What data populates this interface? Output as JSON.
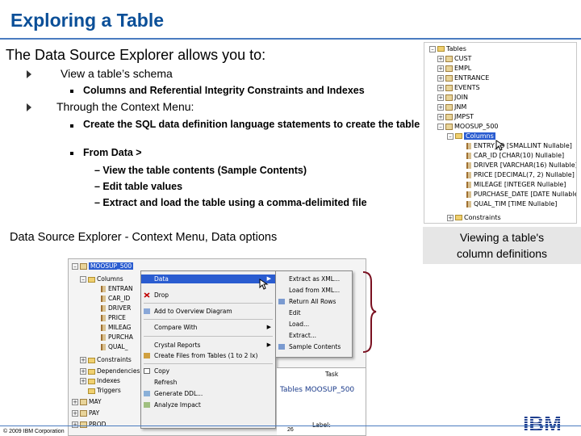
{
  "slide": {
    "title": "Exploring a Table",
    "intro": "The Data Source Explorer allows you to:",
    "bullet1": "View a table’s schema",
    "bullet1_sub1": "Columns and Referential Integrity Constraints and Indexes",
    "bullet2": "Through the Context Menu:",
    "bullet2_sub1": "Create the SQL data definition language statements to create the table",
    "bullet2_sub2": "From Data >",
    "dash1": "– View the table contents (Sample Contents)",
    "dash2": "– Edit table values",
    "dash3": "– Extract and load the table using a comma-delimited file",
    "caption": "Data Source Explorer - Context Menu,  Data options",
    "side_caption_line1": "Viewing a table's",
    "side_caption_line2": "column definitions",
    "footer_copyright": "© 2009 IBM Corporation",
    "page_number": "26",
    "logo_text": "IBM"
  },
  "tree": {
    "root": "Tables",
    "items": [
      "CUST",
      "EMPL",
      "ENTRANCE",
      "EVENTS",
      "JOIN",
      "JNM",
      "JMPST",
      "MOOSUP_500"
    ],
    "columns_folder": "Columns",
    "columns": [
      "ENTRY_ID [SMALLINT Nullable]",
      "CAR_ID [CHAR(10) Nullable]",
      "DRIVER [VARCHAR(16) Nullable]",
      "PRICE [DECIMAL(7, 2) Nullable]",
      "MILEAGE [INTEGER Nullable]",
      "PURCHASE_DATE [DATE Nullable]",
      "QUAL_TIM [TIME Nullable]"
    ],
    "constraints": "Constraints"
  },
  "context_shot": {
    "node": "MOOSUP_500",
    "tree_rows": [
      "Columns",
      "ENTRAN",
      "CAR_ID",
      "DRIVER",
      "PRICE",
      "MILEAG",
      "PURCHA",
      "QUAL_",
      "Constraints",
      "Dependencies",
      "Indexes",
      "Triggers",
      "MAY",
      "PAY",
      "PROD"
    ],
    "menu_items": [
      "Data",
      "Drop",
      "Add to Overview Diagram",
      "Compare With",
      "Crystal Reports",
      "Create Files from Tables (1 to 2 Ix)",
      "Copy",
      "Refresh",
      "Generate DDL...",
      "Analyze Impact"
    ],
    "submenu_items": [
      "Extract as XML...",
      "Load from XML...",
      "Return All Rows",
      "Edit",
      "Load...",
      "Extract...",
      "Sample Contents"
    ],
    "bottom_tab": "Task",
    "bottom_title": "Tables MOOSUP_500",
    "bottom_label": "Label:"
  },
  "colors": {
    "title": "#0b4f98",
    "rule": "#4a7cc0",
    "brace": "#7a1020",
    "selection": "#2a5cd0"
  }
}
